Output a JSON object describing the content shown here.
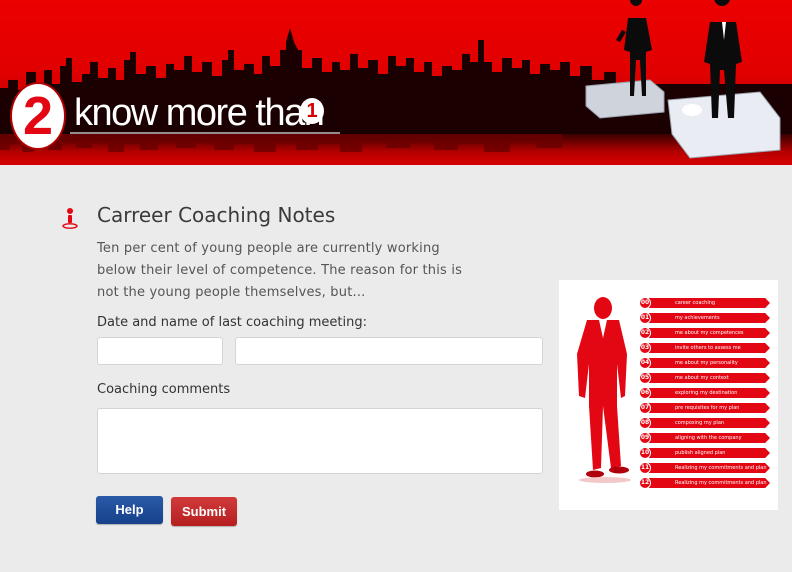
{
  "banner": {
    "logo_number": "2",
    "tagline": "know more than",
    "tagline_number": "1"
  },
  "main": {
    "title": "Carreer Coaching Notes",
    "intro": "Ten per cent of young people are currently working below their level of competence. The reason for this is not the young people themselves, but...",
    "date_label": "Date and name of last coaching meeting:",
    "date_value": "",
    "name_value": "",
    "comments_label": "Coaching comments",
    "comments_value": "",
    "help_label": "Help",
    "submit_label": "Submit"
  },
  "infographic": {
    "steps": [
      {
        "num": "00",
        "label": "career coaching"
      },
      {
        "num": "01",
        "label": "my achievements"
      },
      {
        "num": "02",
        "label": "me about my competences"
      },
      {
        "num": "03",
        "label": "invite others to assess me"
      },
      {
        "num": "04",
        "label": "me about my personality"
      },
      {
        "num": "05",
        "label": "me about my context"
      },
      {
        "num": "06",
        "label": "exploring my destination"
      },
      {
        "num": "07",
        "label": "pre requisites for my plan"
      },
      {
        "num": "08",
        "label": "composing my plan"
      },
      {
        "num": "09",
        "label": "aligning with the company"
      },
      {
        "num": "10",
        "label": "publish aligned plan"
      },
      {
        "num": "11",
        "label": "Realizing my commitments and plan"
      },
      {
        "num": "12",
        "label": "Realizing my commitments and plan"
      }
    ]
  },
  "colors": {
    "brand_red": "#e30613",
    "help_blue": "#1f4c97",
    "submit_red": "#c22a2a",
    "page_bg": "#ebebeb"
  }
}
